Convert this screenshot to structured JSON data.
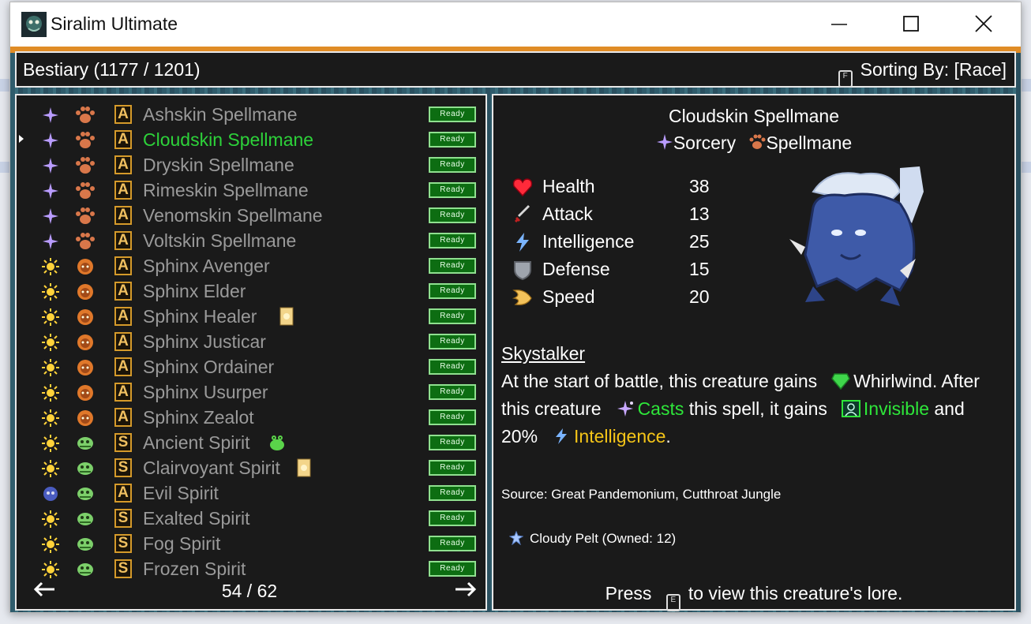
{
  "window": {
    "title": "Siralim Ultimate",
    "controls": [
      "minimize",
      "maximize",
      "close"
    ]
  },
  "header": {
    "title": "Bestiary (1177 / 1201)",
    "sort_key": "F",
    "sorting_label": "Sorting By: [Race]"
  },
  "list": {
    "selected_index": 1,
    "ready_label": "Ready",
    "page": "54 / 62",
    "rows": [
      {
        "name": "Ashskin Spellmane",
        "class_icon": "sorcery-icon",
        "race_icon": "paw-icon",
        "letter": "A",
        "extra_icon": null
      },
      {
        "name": "Cloudskin Spellmane",
        "class_icon": "sorcery-icon",
        "race_icon": "paw-icon",
        "letter": "A",
        "extra_icon": null
      },
      {
        "name": "Dryskin Spellmane",
        "class_icon": "sorcery-icon",
        "race_icon": "paw-icon",
        "letter": "A",
        "extra_icon": null
      },
      {
        "name": "Rimeskin Spellmane",
        "class_icon": "sorcery-icon",
        "race_icon": "paw-icon",
        "letter": "A",
        "extra_icon": null
      },
      {
        "name": "Venomskin Spellmane",
        "class_icon": "sorcery-icon",
        "race_icon": "paw-icon",
        "letter": "A",
        "extra_icon": null
      },
      {
        "name": "Voltskin Spellmane",
        "class_icon": "sorcery-icon",
        "race_icon": "paw-icon",
        "letter": "A",
        "extra_icon": null
      },
      {
        "name": "Sphinx Avenger",
        "class_icon": "life-icon",
        "race_icon": "sphinx-icon",
        "letter": "A",
        "extra_icon": null
      },
      {
        "name": "Sphinx Elder",
        "class_icon": "life-icon",
        "race_icon": "sphinx-icon",
        "letter": "A",
        "extra_icon": null
      },
      {
        "name": "Sphinx Healer",
        "class_icon": "life-icon",
        "race_icon": "sphinx-icon",
        "letter": "A",
        "extra_icon": "card-icon"
      },
      {
        "name": "Sphinx Justicar",
        "class_icon": "life-icon",
        "race_icon": "sphinx-icon",
        "letter": "A",
        "extra_icon": null
      },
      {
        "name": "Sphinx Ordainer",
        "class_icon": "life-icon",
        "race_icon": "sphinx-icon",
        "letter": "A",
        "extra_icon": null
      },
      {
        "name": "Sphinx Usurper",
        "class_icon": "life-icon",
        "race_icon": "sphinx-icon",
        "letter": "A",
        "extra_icon": null
      },
      {
        "name": "Sphinx Zealot",
        "class_icon": "life-icon",
        "race_icon": "sphinx-icon",
        "letter": "A",
        "extra_icon": null
      },
      {
        "name": "Ancient Spirit",
        "class_icon": "life-icon",
        "race_icon": "spirit-icon",
        "letter": "S",
        "extra_icon": "slime-icon"
      },
      {
        "name": "Clairvoyant Spirit",
        "class_icon": "life-icon",
        "race_icon": "spirit-icon",
        "letter": "S",
        "extra_icon": "card-icon"
      },
      {
        "name": "Evil Spirit",
        "class_icon": "death-icon",
        "race_icon": "spirit-icon",
        "letter": "A",
        "extra_icon": null
      },
      {
        "name": "Exalted Spirit",
        "class_icon": "life-icon",
        "race_icon": "spirit-icon",
        "letter": "S",
        "extra_icon": null
      },
      {
        "name": "Fog Spirit",
        "class_icon": "life-icon",
        "race_icon": "spirit-icon",
        "letter": "S",
        "extra_icon": null
      },
      {
        "name": "Frozen Spirit",
        "class_icon": "life-icon",
        "race_icon": "spirit-icon",
        "letter": "S",
        "extra_icon": null
      }
    ]
  },
  "detail": {
    "name": "Cloudskin Spellmane",
    "class": "Sorcery",
    "race": "Spellmane",
    "stats": [
      {
        "label": "Health",
        "value": "38",
        "icon": "heart-icon"
      },
      {
        "label": "Attack",
        "value": "13",
        "icon": "sword-icon"
      },
      {
        "label": "Intelligence",
        "value": "25",
        "icon": "lightning-icon"
      },
      {
        "label": "Defense",
        "value": "15",
        "icon": "shield-icon"
      },
      {
        "label": "Speed",
        "value": "20",
        "icon": "wing-icon"
      }
    ],
    "trait_name": "Skystalker",
    "trait": {
      "p1": "At the start of battle, this creature gains",
      "whirlwind": "Whirlwind. After",
      "p2": "this creature",
      "casts": "Casts",
      "p3": " this spell, it gains",
      "invisible": "Invisible",
      "p4": " and",
      "p5": "20%",
      "intelligence": "Intelligence",
      "p6": "."
    },
    "source": "Source: Great Pandemonium, Cutthroat Jungle",
    "item": "Cloudy Pelt (Owned: 12)",
    "lore_press": "Press",
    "lore_key": "E",
    "lore_rest": "to view this creature's lore."
  }
}
